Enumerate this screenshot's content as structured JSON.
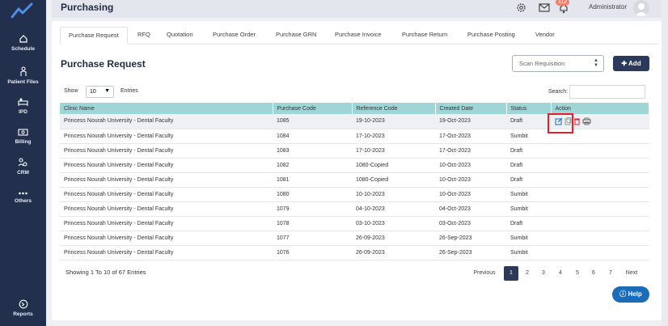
{
  "sidebar": {
    "items": [
      {
        "label": "Schedule",
        "icon": "home-icon"
      },
      {
        "label": "Patient Files",
        "icon": "person-icon"
      },
      {
        "label": "IPD",
        "icon": "bed-icon"
      },
      {
        "label": "Billing",
        "icon": "money-icon"
      },
      {
        "label": "CRM",
        "icon": "people-icon"
      },
      {
        "label": "Others",
        "icon": "dots-icon"
      }
    ],
    "reports_label": "Reports"
  },
  "header": {
    "title": "Purchasing",
    "notification_count": "112",
    "user_name": "Administrator"
  },
  "tabs": [
    {
      "label": "Purchase Request"
    },
    {
      "label": "RFQ"
    },
    {
      "label": "Quotation"
    },
    {
      "label": "Purchase Order"
    },
    {
      "label": "Purchase GRN"
    },
    {
      "label": "Purchase Invoice"
    },
    {
      "label": "Purchase Return"
    },
    {
      "label": "Purchase Posting"
    },
    {
      "label": "Vendor"
    }
  ],
  "main": {
    "title": "Purchase Request",
    "scan_placeholder": "Scan Requisition",
    "add_label": "Add",
    "show_label": "Show",
    "entries_value": "10",
    "entries_label": "Entries",
    "search_label": "Search:"
  },
  "table": {
    "headers": [
      "Clinic Name",
      "Purchase Code",
      "Reference Code",
      "Created Date",
      "Status",
      "Action"
    ],
    "rows": [
      [
        "Princess Nourah University - Dental Faculty",
        "1085",
        "19-10-2023",
        "19-Oct-2023",
        "Draft"
      ],
      [
        "Princess Nourah University - Dental Faculty",
        "1084",
        "17-10-2023",
        "17-Oct-2023",
        "Sumbit"
      ],
      [
        "Princess Nourah University - Dental Faculty",
        "1083",
        "17-10-2023",
        "17-Oct-2023",
        "Draft"
      ],
      [
        "Princess Nourah University - Dental Faculty",
        "1082",
        "1080-Copied",
        "10-Oct-2023",
        "Draft"
      ],
      [
        "Princess Nourah University - Dental Faculty",
        "1081",
        "1080-Copied",
        "10-Oct-2023",
        "Draft"
      ],
      [
        "Princess Nourah University - Dental Faculty",
        "1080",
        "10-10-2023",
        "10-Oct-2023",
        "Sumbit"
      ],
      [
        "Princess Nourah University - Dental Faculty",
        "1079",
        "04-10-2023",
        "04-Oct-2023",
        "Sumbit"
      ],
      [
        "Princess Nourah University - Dental Faculty",
        "1078",
        "03-10-2023",
        "03-Oct-2023",
        "Draft"
      ],
      [
        "Princess Nourah University - Dental Faculty",
        "1077",
        "26-09-2023",
        "26-Sep-2023",
        "Sumbit"
      ],
      [
        "Princess Nourah University - Dental Faculty",
        "1076",
        "26-09-2023",
        "26-Sep-2023",
        "Sumbit"
      ]
    ]
  },
  "pagination": {
    "showing": "Showing 1 To 10 of 67 Entries",
    "previous": "Previous",
    "pages": [
      "1",
      "2",
      "3",
      "4",
      "5",
      "6",
      "7"
    ],
    "next": "Next"
  },
  "help_label": "Help",
  "colors": {
    "sidebar": "#22304d",
    "primary": "#2b3a5a",
    "table_header": "#9fd5d6",
    "badge": "#f0806e",
    "highlight_box": "#e0202c",
    "help": "#1a6cb8"
  }
}
